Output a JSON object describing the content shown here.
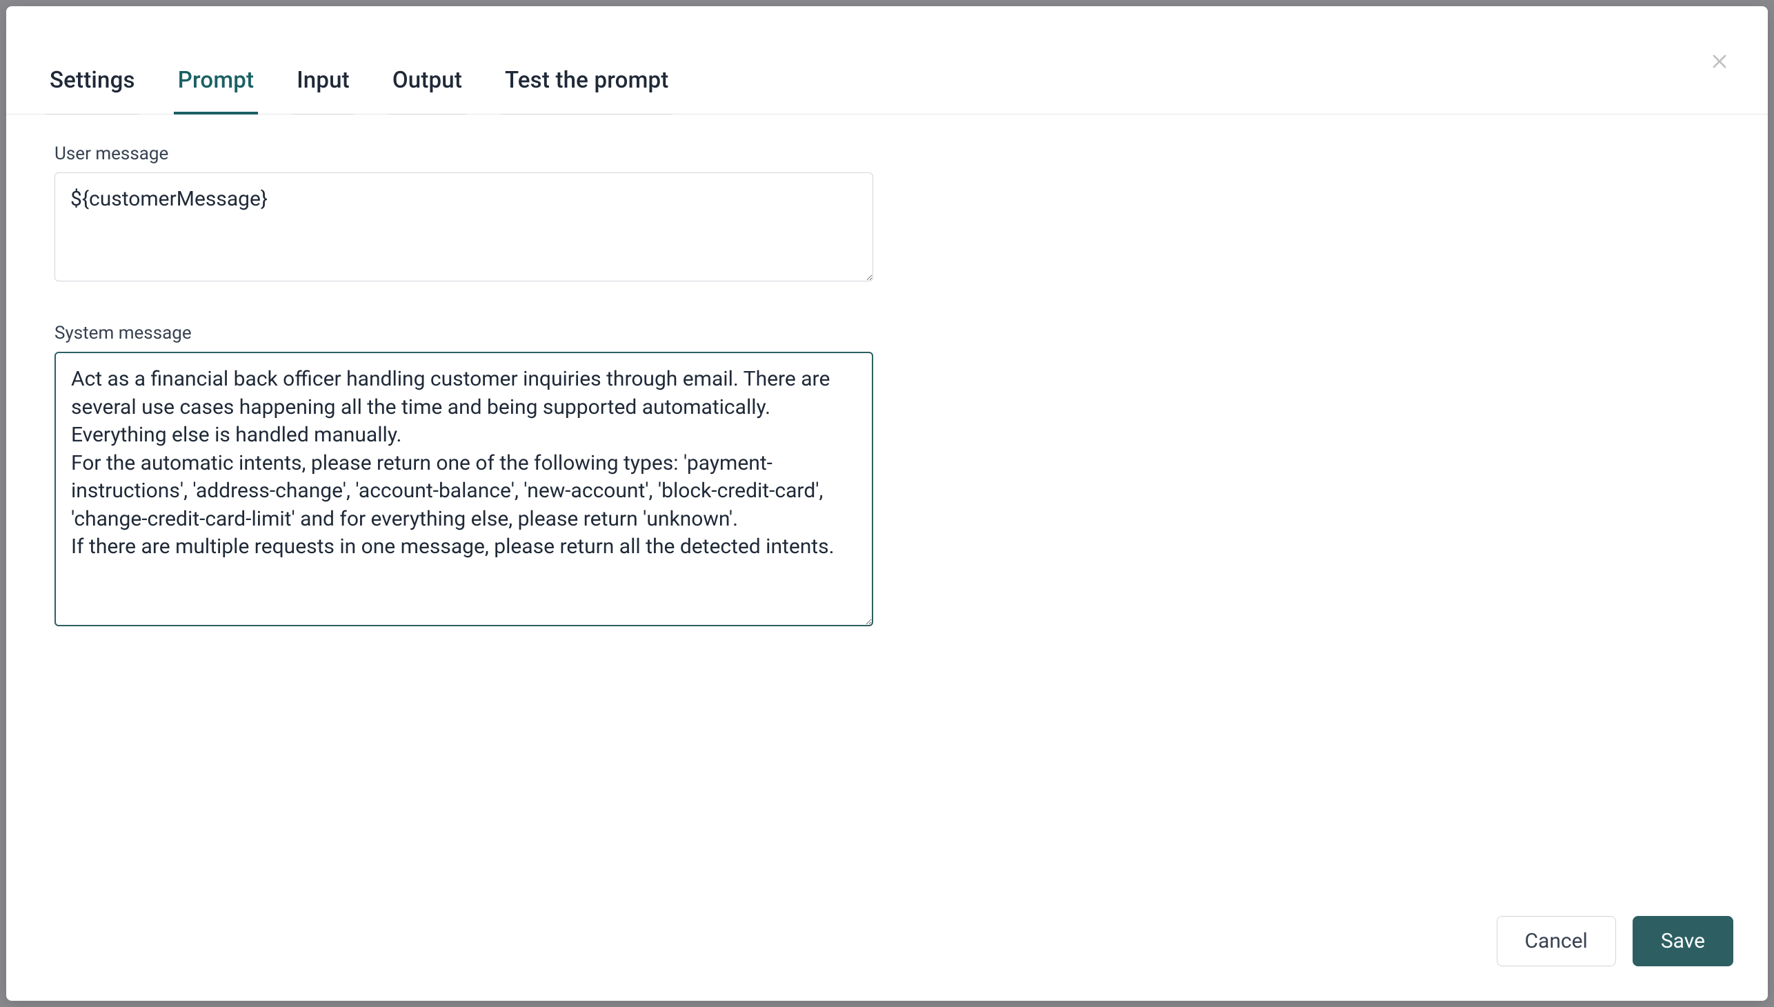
{
  "tabs": [
    {
      "label": "Settings",
      "active": false
    },
    {
      "label": "Prompt",
      "active": true
    },
    {
      "label": "Input",
      "active": false
    },
    {
      "label": "Output",
      "active": false
    },
    {
      "label": "Test the prompt",
      "active": false
    }
  ],
  "fields": {
    "userMessage": {
      "label": "User message",
      "value": "${customerMessage}"
    },
    "systemMessage": {
      "label": "System message",
      "value": "Act as a financial back officer handling customer inquiries through email. There are several use cases happening all the time and being supported automatically. Everything else is handled manually.\nFor the automatic intents, please return one of the following types: 'payment-instructions', 'address-change', 'account-balance', 'new-account', 'block-credit-card', 'change-credit-card-limit' and for everything else, please return 'unknown'.\nIf there are multiple requests in one message, please return all the detected intents."
    }
  },
  "footer": {
    "cancel": "Cancel",
    "save": "Save"
  }
}
